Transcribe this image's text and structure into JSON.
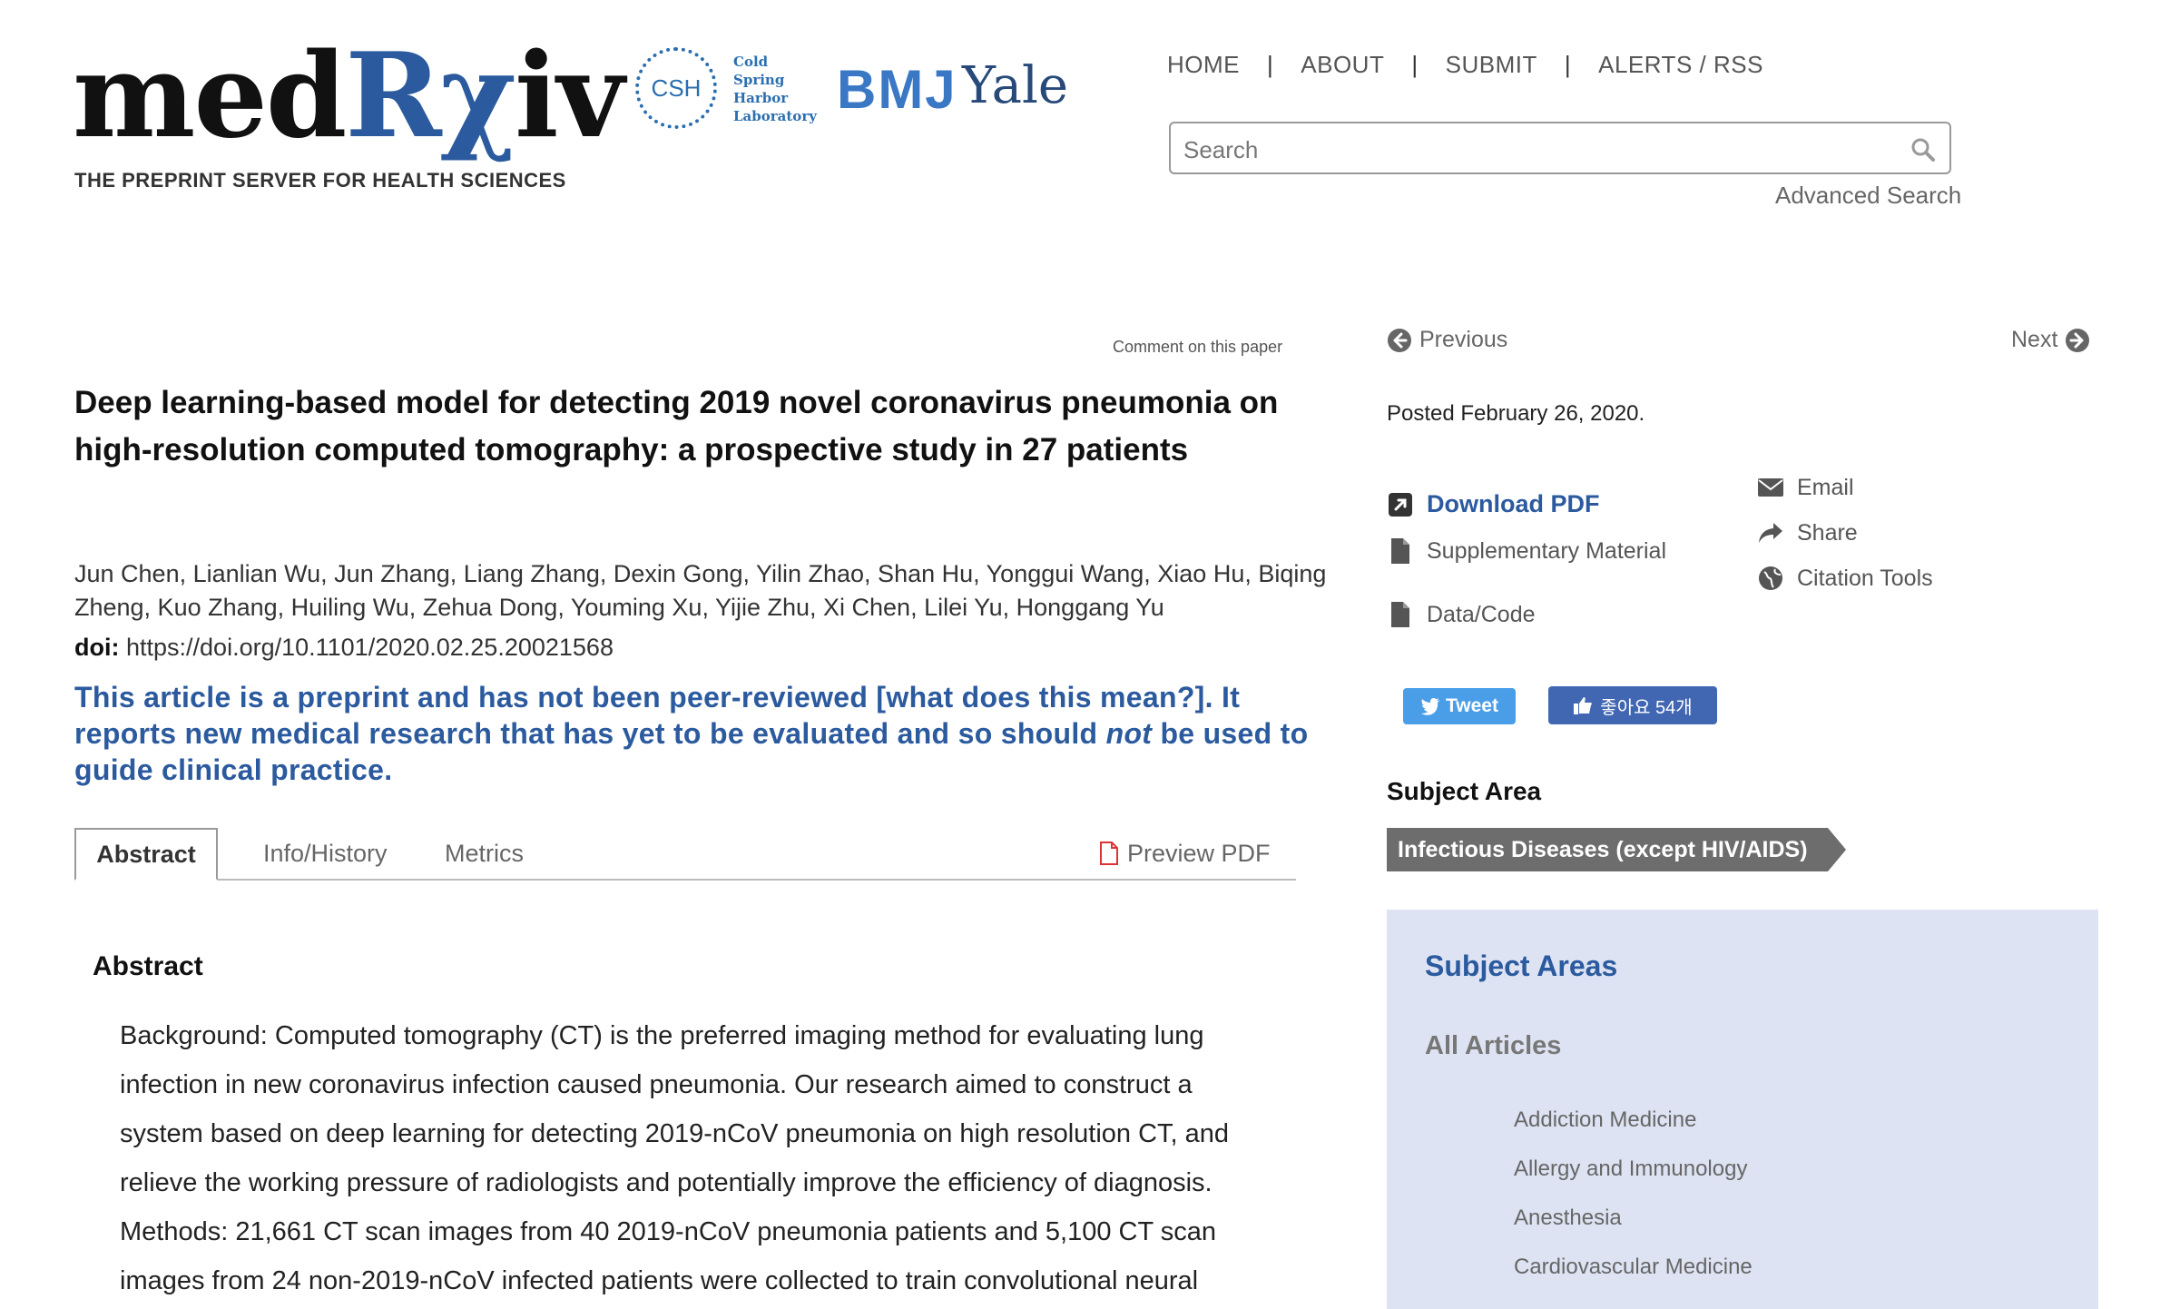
{
  "header": {
    "logo_prefix": "med",
    "logo_rx": "Rχ",
    "logo_suffix": "iv",
    "tagline": "THE PREPRINT SERVER FOR HEALTH SCIENCES",
    "csh_badge": "CSH",
    "csh_lines": [
      "Cold",
      "Spring",
      "Harbor",
      "Laboratory"
    ],
    "bmj": "BMJ",
    "yale": "Yale",
    "nav": [
      "HOME",
      "ABOUT",
      "SUBMIT",
      "ALERTS / RSS"
    ],
    "nav_sep": "|",
    "search_placeholder": "Search",
    "advanced_search": "Advanced Search"
  },
  "article": {
    "comment_link": "Comment on this paper",
    "title": "Deep learning-based model for detecting 2019 novel coronavirus pneumonia on high-resolution computed tomography: a prospective study in 27 patients",
    "authors": "Jun Chen, Lianlian Wu, Jun Zhang, Liang Zhang, Dexin Gong, Yilin Zhao, Shan Hu, Yonggui Wang, Xiao Hu, Biqing Zheng, Kuo Zhang, Huiling Wu, Zehua Dong, Youming Xu, Yijie Zhu, Xi Chen, Lilei Yu, Honggang Yu",
    "doi_label": "doi:",
    "doi_value": "https://doi.org/10.1101/2020.02.25.20021568",
    "preprint_note_a": "This article is a preprint and has not been peer-reviewed [what does this mean?]. It reports new medical research that has yet to be evaluated and so should ",
    "preprint_note_em": "not",
    "preprint_note_b": " be used to guide clinical practice.",
    "tabs": [
      "Abstract",
      "Info/History",
      "Metrics"
    ],
    "preview_pdf": "Preview PDF",
    "abstract_heading": "Abstract",
    "abstract_lines": [
      "Background: Computed tomography (CT) is the preferred imaging method for evaluating lung",
      "infection in new coronavirus infection caused pneumonia. Our research aimed to construct a",
      "system based on deep learning for detecting 2019-nCoV pneumonia on high resolution CT, and",
      "relieve the working pressure of radiologists and potentially improve the efficiency of diagnosis.",
      "Methods: 21,661 CT scan images from 40 2019-nCoV pneumonia patients and 5,100 CT scan",
      "images from 24 non-2019-nCoV infected patients were collected to train convolutional neural"
    ]
  },
  "sidebar": {
    "previous": "Previous",
    "next": "Next",
    "posted": "Posted February 26, 2020.",
    "download_pdf": "Download PDF",
    "supplementary": "Supplementary Material",
    "data_code": "Data/Code",
    "email": "Email",
    "share": "Share",
    "citation_tools": "Citation Tools",
    "tweet": "Tweet",
    "fb_like": "좋아요 54개",
    "subject_area_heading": "Subject Area",
    "subject_tag": "Infectious Diseases (except HIV/AIDS)",
    "panel_title": "Subject Areas",
    "panel_all": "All Articles",
    "panel_items": [
      "Addiction Medicine",
      "Allergy and Immunology",
      "Anesthesia",
      "Cardiovascular Medicine"
    ]
  },
  "colors": {
    "brand_blue": "#2b5a9e",
    "panel_bg": "#dde3f2",
    "tag_gray": "#6d6d6d",
    "twitter": "#4a9ee8",
    "facebook": "#4267b2"
  }
}
